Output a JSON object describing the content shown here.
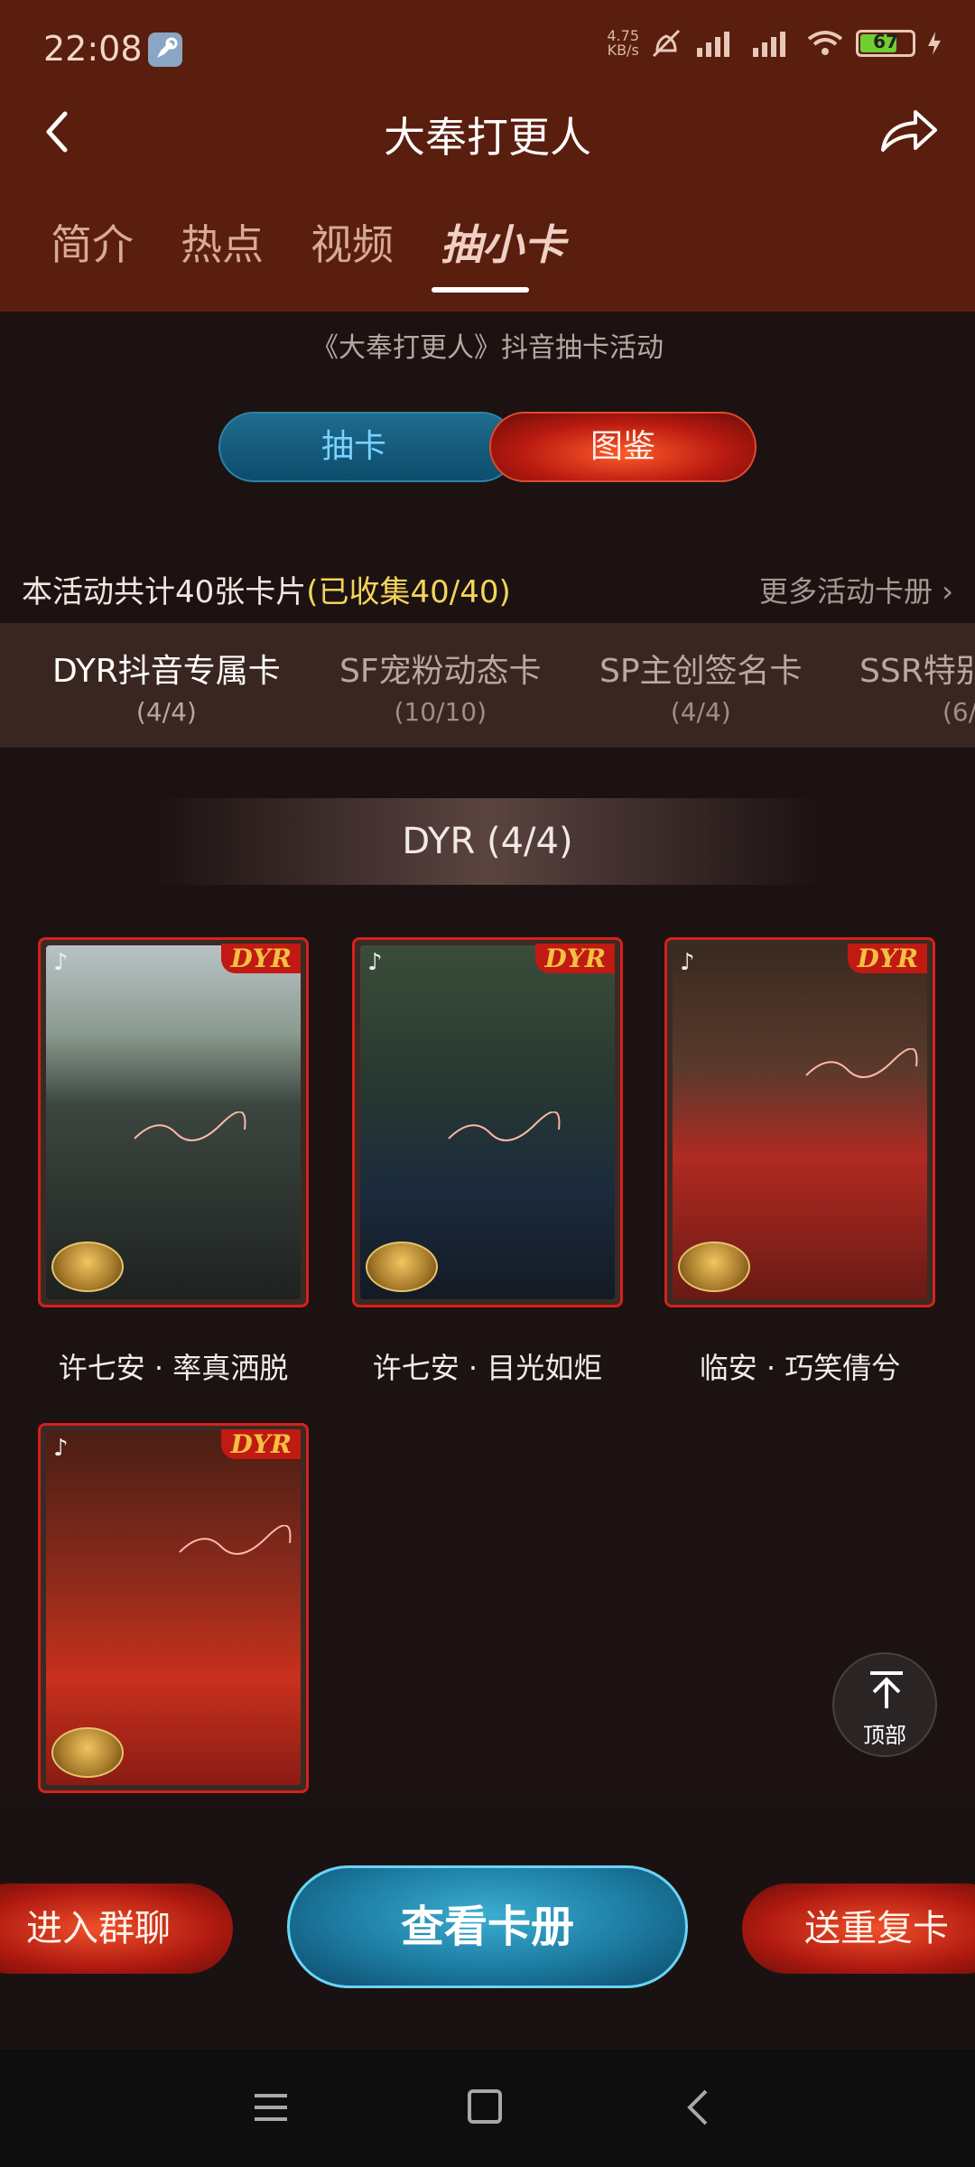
{
  "status_bar": {
    "time": "22:08",
    "net_speed_value": "4.75",
    "net_speed_unit": "KB/s",
    "battery": "67"
  },
  "nav": {
    "title": "大奉打更人"
  },
  "tabs": [
    {
      "label": "简介"
    },
    {
      "label": "热点"
    },
    {
      "label": "视频"
    },
    {
      "label": "抽小卡",
      "active": true
    }
  ],
  "activity": {
    "subtitle": "《大奉打更人》抖音抽卡活动",
    "switch_left": "抽卡",
    "switch_right": "图鉴",
    "collect_text": "本活动共计40张卡片",
    "collect_progress": "(已收集40/40)",
    "more_albums": "更多活动卡册"
  },
  "categories": [
    {
      "name": "DYR抖音专属卡",
      "count": "(4/4)",
      "active": true
    },
    {
      "name": "SF宠粉动态卡",
      "count": "(10/10)"
    },
    {
      "name": "SP主创签名卡",
      "count": "(4/4)"
    },
    {
      "name": "SSR特别",
      "count": "(6/"
    }
  ],
  "section": {
    "title": "DYR (4/4)"
  },
  "cards": [
    {
      "tag": "DYR",
      "label": "许七安 · 率真洒脱"
    },
    {
      "tag": "DYR",
      "label": "许七安 · 目光如炬"
    },
    {
      "tag": "DYR",
      "label": "临安 · 巧笑倩兮"
    },
    {
      "tag": "DYR",
      "label": ""
    }
  ],
  "top_button": {
    "label": "顶部"
  },
  "actions": {
    "left": "进入群聊",
    "center": "查看卡册",
    "right": "送重复卡"
  },
  "colors": {
    "header_bg": "#5a1e0e",
    "card_border": "#d8201a",
    "accent_blue": "#1c7aa0",
    "accent_red": "#b01a10",
    "highlight_yellow": "#f5d45a"
  }
}
